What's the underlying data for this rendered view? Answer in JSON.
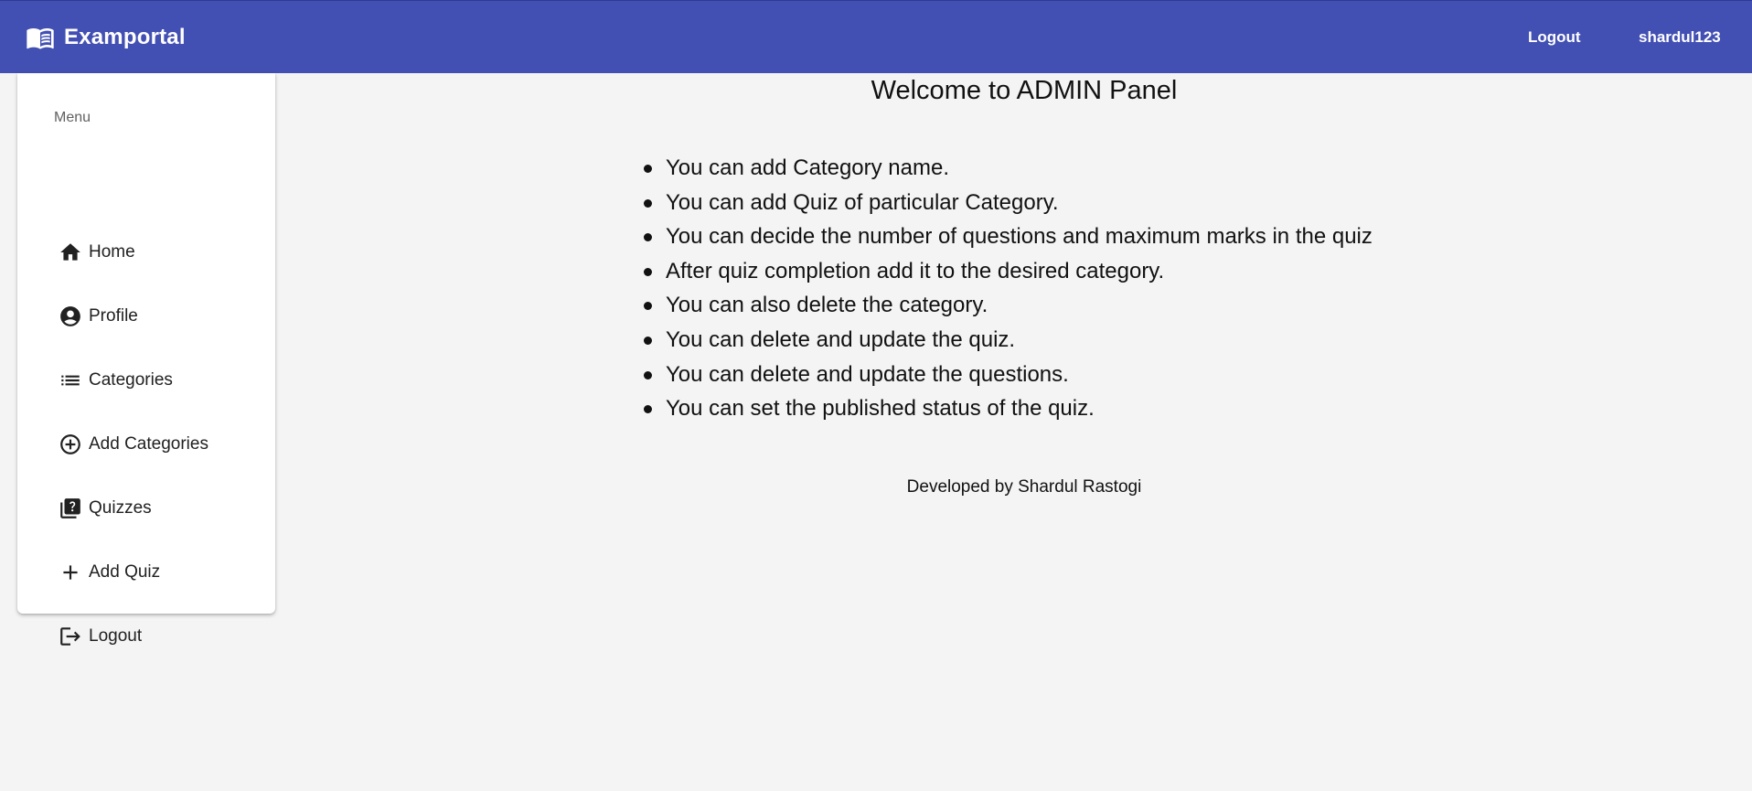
{
  "header": {
    "brand_icon": "menu-book-icon",
    "brand_title": "Examportal",
    "logout_label": "Logout",
    "username": "shardul123",
    "background_color": "#4350b3"
  },
  "sidebar": {
    "menu_header": "Menu",
    "items": [
      {
        "label": "Home",
        "icon": "home-icon"
      },
      {
        "label": "Profile",
        "icon": "account-circle-icon"
      },
      {
        "label": "Categories",
        "icon": "list-icon"
      },
      {
        "label": "Add Categories",
        "icon": "add-circle-outline-icon"
      },
      {
        "label": "Quizzes",
        "icon": "quiz-icon"
      },
      {
        "label": "Add Quiz",
        "icon": "add-icon"
      },
      {
        "label": "Logout",
        "icon": "logout-icon"
      }
    ]
  },
  "main": {
    "title": "Welcome to ADMIN Panel",
    "bullets": [
      "You can add Category name.",
      "You can add Quiz of particular Category.",
      "You can decide the number of questions and maximum marks in the quiz",
      "After quiz completion add it to the desired category.",
      "You can also delete the category.",
      "You can delete and update the quiz.",
      "You can delete and update the questions.",
      "You can set the published status of the quiz."
    ],
    "footer": "Developed by Shardul Rastogi"
  }
}
